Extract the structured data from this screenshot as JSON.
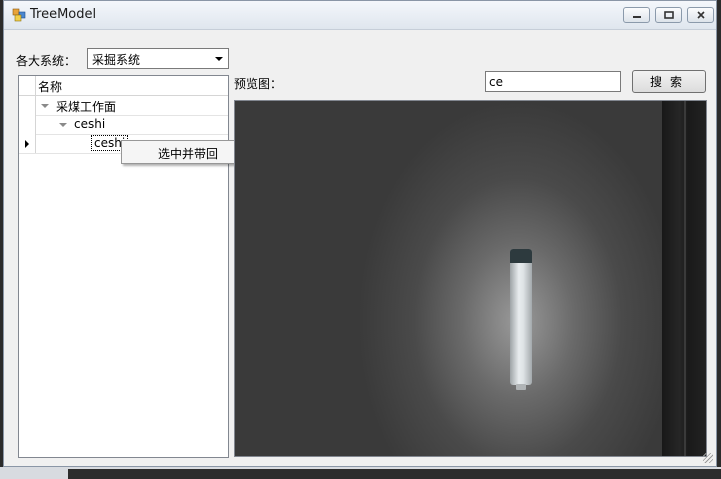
{
  "window": {
    "title": "TreeModel"
  },
  "filter": {
    "label": "各大系统：",
    "selected": "采掘系统"
  },
  "tree": {
    "column_header": "名称",
    "rows": [
      {
        "label": "采煤工作面",
        "level": 0
      },
      {
        "label": "ceshi",
        "level": 1
      },
      {
        "label": "ceshi",
        "level": 2
      }
    ]
  },
  "context_menu": {
    "item": "选中并带回"
  },
  "preview": {
    "label": "预览图："
  },
  "search": {
    "value": "ce",
    "button_label": "搜索"
  },
  "colors": {
    "window_bg": "#f0f0f0",
    "titlebar": "#dfe6ee",
    "preview_bg": "#4a4a4a"
  },
  "icons": {
    "app": "app-window-icon",
    "minimize": "minimize-icon",
    "maximize": "maximize-icon",
    "close": "close-icon"
  }
}
